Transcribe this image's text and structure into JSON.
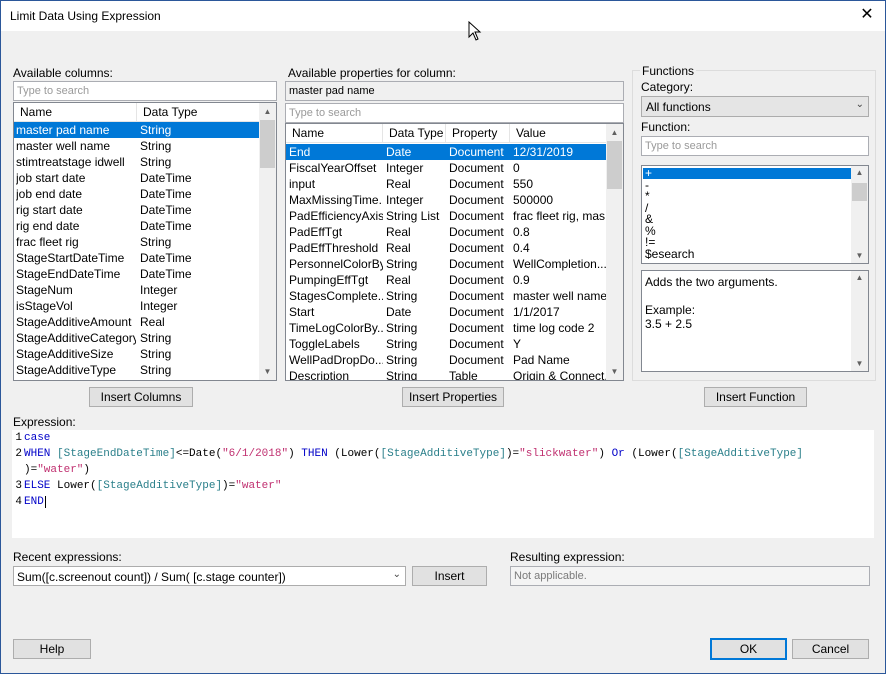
{
  "window": {
    "title": "Limit Data Using Expression",
    "close_glyph": "✕"
  },
  "columns_panel": {
    "label": "Available columns:",
    "search_placeholder": "Type to search",
    "headers": [
      "Name",
      "Data Type"
    ],
    "rows": [
      [
        "master pad name",
        "String"
      ],
      [
        "master well name",
        "String"
      ],
      [
        "stimtreatstage idwell",
        "String"
      ],
      [
        "job start date",
        "DateTime"
      ],
      [
        "job end date",
        "DateTime"
      ],
      [
        "rig start date",
        "DateTime"
      ],
      [
        "rig end date",
        "DateTime"
      ],
      [
        "frac fleet rig",
        "String"
      ],
      [
        "StageStartDateTime",
        "DateTime"
      ],
      [
        "StageEndDateTime",
        "DateTime"
      ],
      [
        "StageNum",
        "Integer"
      ],
      [
        "isStageVol",
        "Integer"
      ],
      [
        "StageAdditiveAmount",
        "Real"
      ],
      [
        "StageAdditiveCategory",
        "String"
      ],
      [
        "StageAdditiveSize",
        "String"
      ],
      [
        "StageAdditiveType",
        "String"
      ]
    ],
    "selected_index": 0,
    "insert_button": "Insert Columns"
  },
  "properties_panel": {
    "label": "Available properties for column:",
    "column_value": "master pad name",
    "search_placeholder": "Type to search",
    "headers": [
      "Name",
      "Data Type",
      "Property ...",
      "Value"
    ],
    "rows": [
      [
        "End",
        "Date",
        "Document",
        "12/31/2019"
      ],
      [
        "FiscalYearOffset",
        "Integer",
        "Document",
        "0"
      ],
      [
        "input",
        "Real",
        "Document",
        "550"
      ],
      [
        "MaxMissingTime...",
        "Integer",
        "Document",
        "500000"
      ],
      [
        "PadEfficiencyAxis",
        "String List",
        "Document",
        "frac fleet rig, mas..."
      ],
      [
        "PadEffTgt",
        "Real",
        "Document",
        "0.8"
      ],
      [
        "PadEffThreshold",
        "Real",
        "Document",
        "0.4"
      ],
      [
        "PersonnelColorBy",
        "String",
        "Document",
        "WellCompletion..."
      ],
      [
        "PumpingEffTgt",
        "Real",
        "Document",
        "0.9"
      ],
      [
        "StagesComplete...",
        "String",
        "Document",
        "master well name"
      ],
      [
        "Start",
        "Date",
        "Document",
        "1/1/2017"
      ],
      [
        "TimeLogColorBy...",
        "String",
        "Document",
        "time log code 2"
      ],
      [
        "ToggleLabels",
        "String",
        "Document",
        "Y"
      ],
      [
        "WellPadDropDo...",
        "String",
        "Document",
        "Pad Name"
      ],
      [
        "Description",
        "String",
        "Table",
        "Origin & Connect..."
      ]
    ],
    "selected_index": 0,
    "insert_button": "Insert Properties"
  },
  "functions_panel": {
    "group_label": "Functions",
    "category_label": "Category:",
    "category_value": "All functions",
    "function_label": "Function:",
    "search_placeholder": "Type to search",
    "items": [
      "+",
      "-",
      "*",
      "/",
      "&",
      "%",
      "!=",
      "$esearch"
    ],
    "selected_index": 0,
    "description": "Adds the two arguments.",
    "example_label": "Example:",
    "example_value": "3.5 + 2.5",
    "insert_button": "Insert Function"
  },
  "expression": {
    "label": "Expression:",
    "line_numbers": [
      "1",
      "2",
      "3",
      "4"
    ],
    "lines": {
      "l1": {
        "kw": "case"
      },
      "l2": {
        "kw1": "WHEN ",
        "c1": "[StageEndDateTime]",
        "t1": "<=Date(",
        "s1": "\"6/1/2018\"",
        "t2": ") ",
        "kw2": "THEN ",
        "t3": "(Lower(",
        "c2": "[StageAdditiveType]",
        "t4": ")=",
        "s2": "\"slickwater\"",
        "t5": ") ",
        "kw3": "Or ",
        "t6": "(Lower(",
        "c3": "[StageAdditiveType]"
      },
      "l2b": {
        "t1": ")=",
        "s1": "\"water\"",
        "t2": ")"
      },
      "l3": {
        "kw1": "ELSE ",
        "t1": "Lower(",
        "c1": "[StageAdditiveType]",
        "t2": ")=",
        "s1": "\"water\""
      },
      "l4": {
        "kw": "END"
      }
    }
  },
  "recent": {
    "label": "Recent expressions:",
    "value": "Sum([c.screenout count]) / Sum( [c.stage counter])",
    "insert_button": "Insert"
  },
  "result": {
    "label": "Resulting expression:",
    "value": "Not applicable."
  },
  "footer": {
    "help": "Help",
    "ok": "OK",
    "cancel": "Cancel"
  },
  "colors": {
    "selection": "#0078d7",
    "keyword": "#0000c8",
    "column": "#2a7f8a",
    "string": "#c03070"
  },
  "icons": [
    "close-icon",
    "mouse-cursor-icon",
    "chevron-down-icon",
    "scroll-up-arrow-icon",
    "scroll-down-arrow-icon"
  ]
}
